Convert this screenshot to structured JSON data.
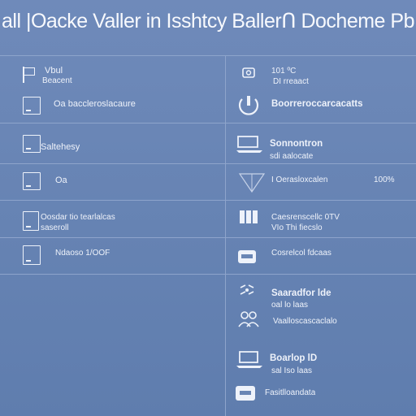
{
  "title": "all |Oacke Valler in Isshtcy Ballerꓵ Docheme Pb",
  "left_column": {
    "rows": [
      {
        "icon": "flag-icon",
        "line1": "Vbul",
        "line2": "Beacent"
      },
      {
        "icon": "document-icon",
        "line1": "Oa baccleroslacaure",
        "line2": ""
      },
      {
        "icon": "document-icon",
        "line1": "Saltehesy",
        "line2": ""
      },
      {
        "icon": "document-icon",
        "line1": "Oa",
        "line2": ""
      },
      {
        "icon": "document-icon",
        "line1": "Oosdar tio tearlalcas",
        "line2": "saseroll"
      },
      {
        "icon": "document-icon",
        "line1": "Ndaoso 1/OOF",
        "line2": ""
      }
    ]
  },
  "right_column": {
    "rows": [
      {
        "icon": "camera-icon",
        "line1": "101 ºC",
        "line2": "DI rreaact"
      },
      {
        "icon": "power-icon",
        "line1": "Boorreroccarcacatts",
        "line2": ""
      },
      {
        "icon": "laptop-icon",
        "line1": "Sonnontron",
        "line2": "sdi aalocate"
      },
      {
        "icon": "triangle-icon",
        "line1": "I Oerasloxcalen",
        "line2": "",
        "value": "100%"
      },
      {
        "icon": "grid-icon",
        "line1": "Caesrenscellc 0TV",
        "line2": "VIo Thi fiecslo"
      },
      {
        "icon": "toolbox-icon",
        "line1": "Cosrelcol fdcaas",
        "line2": ""
      },
      {
        "icon": "link-icon",
        "line1": "Saaradfor lde",
        "line2": "oal lo laas"
      },
      {
        "icon": "people-icon",
        "line1": "Vaalloscascaclalo",
        "line2": ""
      },
      {
        "icon": "laptop-icon",
        "line1": "Boarlop lD",
        "line2": "sal Iso laas"
      },
      {
        "icon": "toolbox-icon",
        "line1": "Fasitlloandata",
        "line2": ""
      }
    ]
  }
}
